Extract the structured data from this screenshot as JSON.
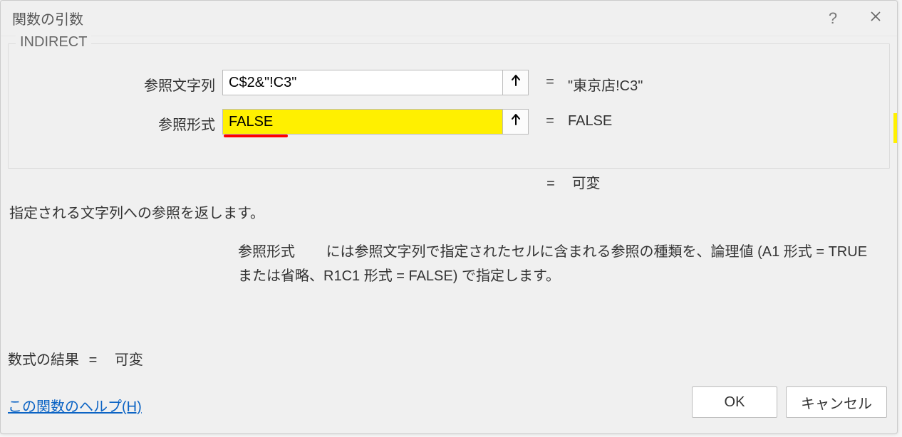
{
  "titlebar": {
    "title": "関数の引数"
  },
  "group": {
    "legend": "INDIRECT",
    "params": [
      {
        "label": "参照文字列",
        "value": "C$2&\"!C3\"",
        "evaluated": "\"東京店!C3\""
      },
      {
        "label": "参照形式",
        "value": "FALSE",
        "evaluated": "FALSE"
      }
    ]
  },
  "overall_eval": {
    "value": "可変"
  },
  "description": "指定される文字列への参照を返します。",
  "arg_help": {
    "name": "参照形式",
    "text": "には参照文字列で指定されたセルに含まれる参照の種類を、論理値 (A1 形式 = TRUE または省略、R1C1 形式 = FALSE) で指定します。"
  },
  "formula_result": {
    "label": "数式の結果",
    "value": "可変"
  },
  "help_link": "この関数のヘルプ(H)",
  "buttons": {
    "ok": "OK",
    "cancel": "キャンセル"
  },
  "equals": "="
}
